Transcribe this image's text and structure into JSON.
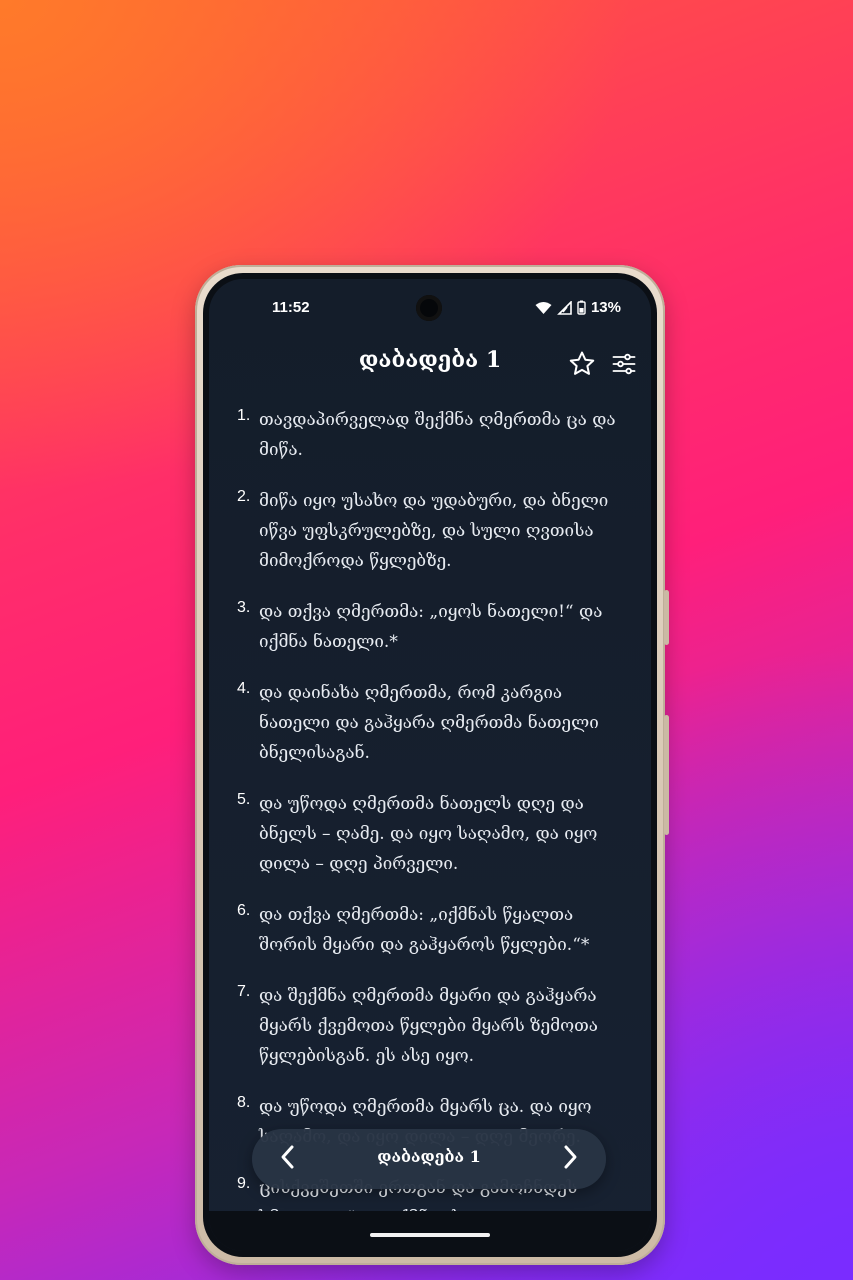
{
  "status_bar": {
    "time": "11:52",
    "battery": "13%",
    "icons": [
      "wifi-icon",
      "signal-icon",
      "battery-icon"
    ]
  },
  "header": {
    "title": "დაბადება 1",
    "icons": [
      "star-icon",
      "settings-sliders-icon"
    ]
  },
  "verses": [
    {
      "num": "1.",
      "text": "თავდაპირველად შექმნა ღმერთმა ცა და მიწა."
    },
    {
      "num": "2.",
      "text": "მიწა იყო უსახო და უდაბური, და ბნელი იწვა უფსკრულებზე, და სული ღვთისა მიმოქროდა წყლებზე."
    },
    {
      "num": "3.",
      "text": "და თქვა ღმერთმა: „იყოს ნათელი!“ და იქმნა ნათელი.*"
    },
    {
      "num": "4.",
      "text": "და დაინახა ღმერთმა, რომ კარგია ნათელი და გაჰყარა ღმერთმა ნათელი ბნელისაგან."
    },
    {
      "num": "5.",
      "text": "და უწოდა ღმერთმა ნათელს დღე და ბნელს – ღამე. და იყო საღამო, და იყო დილა – დღე პირველი."
    },
    {
      "num": "6.",
      "text": "და თქვა ღმერთმა: „იქმნას წყალთა შორის მყარი და გაჰყაროს წყლები.“*"
    },
    {
      "num": "7.",
      "text": "და შექმნა ღმერთმა მყარი და გაჰყარა მყარს ქვემოთა წყლები მყარს ზემოთა წყლებისგან. ეს ასე იყო."
    },
    {
      "num": "8.",
      "text": "და უწოდა ღმერთმა მყარს ცა. და იყო საღამო, და იყო დილა – დღე მეორე."
    },
    {
      "num": "9.",
      "text": "ცისქვეშეთში ერთგან და გამოჩნდეს ხმელეთი.“ და იქმნა ასე."
    }
  ],
  "bottom_nav": {
    "title": "დაბადება 1",
    "prev_icon": "chevron-left-icon",
    "next_icon": "chevron-right-icon"
  }
}
